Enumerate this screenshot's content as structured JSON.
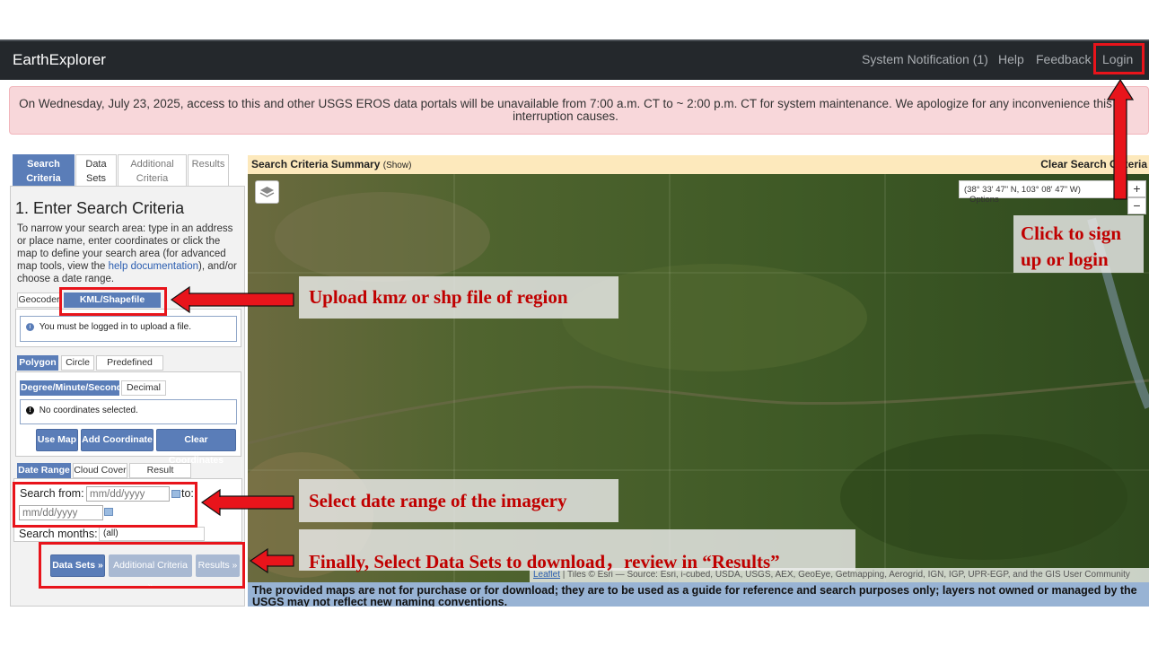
{
  "navbar": {
    "brand": "EarthExplorer",
    "notification": "System Notification (1)",
    "help": "Help",
    "feedback": "Feedback",
    "login": "Login"
  },
  "banner": {
    "message": "On Wednesday, July 23, 2025, access to this and other USGS EROS data portals will be unavailable from 7:00 a.m. CT to ~ 2:00 p.m. CT for system maintenance. We apologize for any inconvenience this interruption causes."
  },
  "tabs": {
    "search_l1": "Search",
    "search_l2": "Criteria",
    "datasets_l1": "Data",
    "datasets_l2": "Sets",
    "additional_l1": "Additional",
    "additional_l2": "Criteria",
    "results": "Results"
  },
  "criteria": {
    "heading": "1. Enter Search Criteria",
    "help_before": "To narrow your search area: type in an address or place name, enter coordinates or click the map to define your search area (for advanced map tools, view the ",
    "help_link": "help documentation",
    "help_after": "), and/or choose a date range.",
    "geocoder_tab": "Geocoder",
    "kml_tab": "KML/Shapefile Upload",
    "login_msg": "You must be logged in to upload a file.",
    "polygon_tab": "Polygon",
    "circle_tab": "Circle",
    "predefined_tab": "Predefined Area",
    "dms_tab": "Degree/Minute/Second",
    "decimal_tab": "Decimal",
    "no_coords": "No coordinates selected.",
    "use_map": "Use Map",
    "add_coord": "Add Coordinate",
    "clear_coords": "Clear Coordinates",
    "date_range_tab": "Date Range",
    "cloud_cover_tab": "Cloud Cover",
    "result_options_tab": "Result Options",
    "search_from_label": "Search from:",
    "date_placeholder": "mm/dd/yyyy",
    "to_label": "to:",
    "search_months_label": "Search months:",
    "search_months_value": "(all)",
    "btn_datasets": "Data Sets »",
    "btn_additional": "Additional Criteria »",
    "btn_results": "Results »"
  },
  "map": {
    "summary_title": "Search Criteria Summary",
    "summary_show": "(Show)",
    "clear_criteria": "Clear Search Criteria",
    "coords": "(38° 33' 47\" N, 103° 08' 47\" W)",
    "options": "Options",
    "zoom_in": "+",
    "zoom_out": "−",
    "attribution_link": "Leaflet",
    "attribution_text": " | Tiles © Esri — Source: Esri, i-cubed, USDA, USGS, AEX, GeoEye, Getmapping, Aerogrid, IGN, IGP, UPR-EGP, and the GIS User Community",
    "disclaimer": "The provided maps are not for purchase or for download; they are to be used as a guide for reference and search purposes only; layers not owned or managed by the USGS may not reflect new naming conventions."
  },
  "annotations": {
    "upload": "Upload kmz or shp file of region",
    "date": "Select date range of the imagery",
    "finally": "Finally, Select Data Sets to download，review in “Results”",
    "login_l1": "Click to sign",
    "login_l2": "up or login"
  },
  "colors": {
    "navbar": "#24282c",
    "accent": "#5a7db8",
    "banner": "#f8d7da",
    "annotation_red": "#e8141b"
  }
}
